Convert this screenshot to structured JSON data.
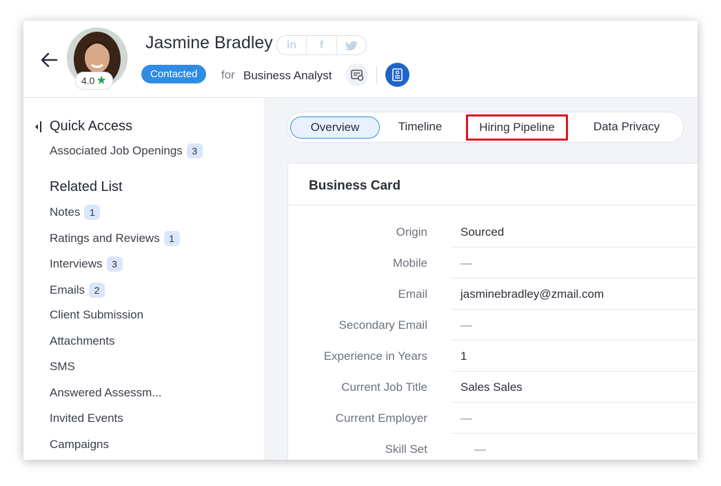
{
  "header": {
    "name": "Jasmine Bradley",
    "rating": "4.0",
    "status": "Contacted",
    "for_text": "for",
    "job_title": "Business Analyst",
    "socials": [
      "in",
      "f",
      "twitter"
    ]
  },
  "sidebar": {
    "quick_access_title": "Quick Access",
    "quick_access_items": [
      {
        "label": "Associated Job Openings",
        "count": "3"
      }
    ],
    "related_list_title": "Related List",
    "related_items": [
      {
        "label": "Notes",
        "count": "1"
      },
      {
        "label": "Ratings and Reviews",
        "count": "1"
      },
      {
        "label": "Interviews",
        "count": "3"
      },
      {
        "label": "Emails",
        "count": "2"
      },
      {
        "label": "Client Submission"
      },
      {
        "label": "Attachments"
      },
      {
        "label": "SMS"
      },
      {
        "label": "Answered Assessm..."
      },
      {
        "label": "Invited Events"
      },
      {
        "label": "Campaigns"
      }
    ]
  },
  "tabs": [
    "Overview",
    "Timeline",
    "Hiring Pipeline",
    "Data Privacy"
  ],
  "card": {
    "title": "Business Card",
    "fields": [
      {
        "label": "Origin",
        "value": "Sourced"
      },
      {
        "label": "Mobile",
        "value": "—"
      },
      {
        "label": "Email",
        "value": "jasminebradley@zmail.com"
      },
      {
        "label": "Secondary Email",
        "value": "—"
      },
      {
        "label": "Experience in Years",
        "value": "1"
      },
      {
        "label": "Current Job Title",
        "value": "Sales Sales"
      },
      {
        "label": "Current Employer",
        "value": "—"
      },
      {
        "label": "Skill Set",
        "value": "—"
      }
    ]
  },
  "colors": {
    "accent": "#2f8ce5",
    "highlight": "#e0131f",
    "rating_star": "#2b9b5b",
    "count_badge": "#d9e6fb"
  }
}
